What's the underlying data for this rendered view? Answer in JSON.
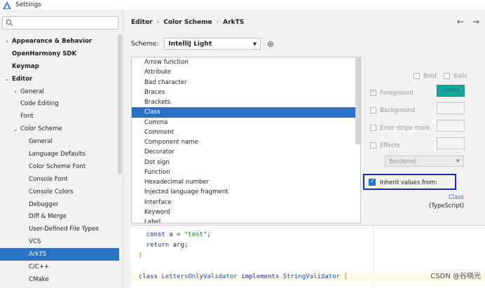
{
  "window": {
    "title": "Settings"
  },
  "search": {
    "placeholder": ""
  },
  "sidebar": {
    "items": [
      {
        "label": "Appearance & Behavior",
        "arrow": "›",
        "bold": true,
        "indent": 0
      },
      {
        "label": "OpenHarmony SDK",
        "arrow": "",
        "bold": true,
        "indent": 0
      },
      {
        "label": "Keymap",
        "arrow": "",
        "bold": true,
        "indent": 0
      },
      {
        "label": "Editor",
        "arrow": "⌄",
        "bold": true,
        "indent": 0
      },
      {
        "label": "General",
        "arrow": "›",
        "bold": false,
        "indent": 1
      },
      {
        "label": "Code Editing",
        "arrow": "",
        "bold": false,
        "indent": 1
      },
      {
        "label": "Font",
        "arrow": "",
        "bold": false,
        "indent": 1
      },
      {
        "label": "Color Scheme",
        "arrow": "⌄",
        "bold": false,
        "indent": 1
      },
      {
        "label": "General",
        "arrow": "",
        "bold": false,
        "indent": 2
      },
      {
        "label": "Language Defaults",
        "arrow": "",
        "bold": false,
        "indent": 2
      },
      {
        "label": "Color Scheme Font",
        "arrow": "",
        "bold": false,
        "indent": 2
      },
      {
        "label": "Console Font",
        "arrow": "",
        "bold": false,
        "indent": 2
      },
      {
        "label": "Console Colors",
        "arrow": "",
        "bold": false,
        "indent": 2
      },
      {
        "label": "Debugger",
        "arrow": "",
        "bold": false,
        "indent": 2
      },
      {
        "label": "Diff & Merge",
        "arrow": "",
        "bold": false,
        "indent": 2
      },
      {
        "label": "User-Defined File Types",
        "arrow": "",
        "bold": false,
        "indent": 2
      },
      {
        "label": "VCS",
        "arrow": "",
        "bold": false,
        "indent": 2
      },
      {
        "label": "ArkTS",
        "arrow": "",
        "bold": false,
        "indent": 2,
        "selected": true
      },
      {
        "label": "C/C++",
        "arrow": "",
        "bold": false,
        "indent": 2
      },
      {
        "label": "CMake",
        "arrow": "",
        "bold": false,
        "indent": 2
      }
    ]
  },
  "breadcrumb": {
    "part1": "Editor",
    "part2": "Color Scheme",
    "part3": "ArkTS",
    "separator": "›"
  },
  "nav": {
    "back": "←",
    "forward": "→"
  },
  "scheme": {
    "label": "Scheme:",
    "value": "IntelliJ Light"
  },
  "elements": {
    "items": [
      "Arrow function",
      "Attribute",
      "Bad character",
      "Braces",
      "Brackets",
      "Class",
      "Comma",
      "Comment",
      "Component name",
      "Decorator",
      "Dot sign",
      "Function",
      "Hexadecimal number",
      "Injected language fragment",
      "Interface",
      "Keyword",
      "Label"
    ],
    "selected_index": 5
  },
  "options": {
    "bold_label": "Bold",
    "italic_label": "Italic",
    "foreground_label": "Foreground",
    "foreground_value": "16A89A",
    "foreground_color": "#16a89a",
    "background_label": "Background",
    "error_stripe_label": "Error stripe mark",
    "effects_label": "Effects",
    "effects_select": "Bordered",
    "inherit_label": "Inherit values from:",
    "inherit_link": "Class",
    "inherit_sub": "(TypeScript)"
  },
  "code": {
    "line1": {
      "kw": "const",
      "mid": " a = ",
      "str": "\"test\"",
      "end": ";"
    },
    "line2": {
      "kw": "return",
      "end": " arg;"
    },
    "line3": {
      "brace": "}"
    },
    "line4": {
      "kw1": "class",
      "cls1": " LettersOnlyValidator ",
      "kw2": "implements",
      "cls2": " StringValidator ",
      "brace": "{"
    }
  },
  "watermark": "CSDN @谷晓光",
  "colors": {
    "selection": "#2b72c7",
    "highlight_border": "#1d2ab8"
  }
}
